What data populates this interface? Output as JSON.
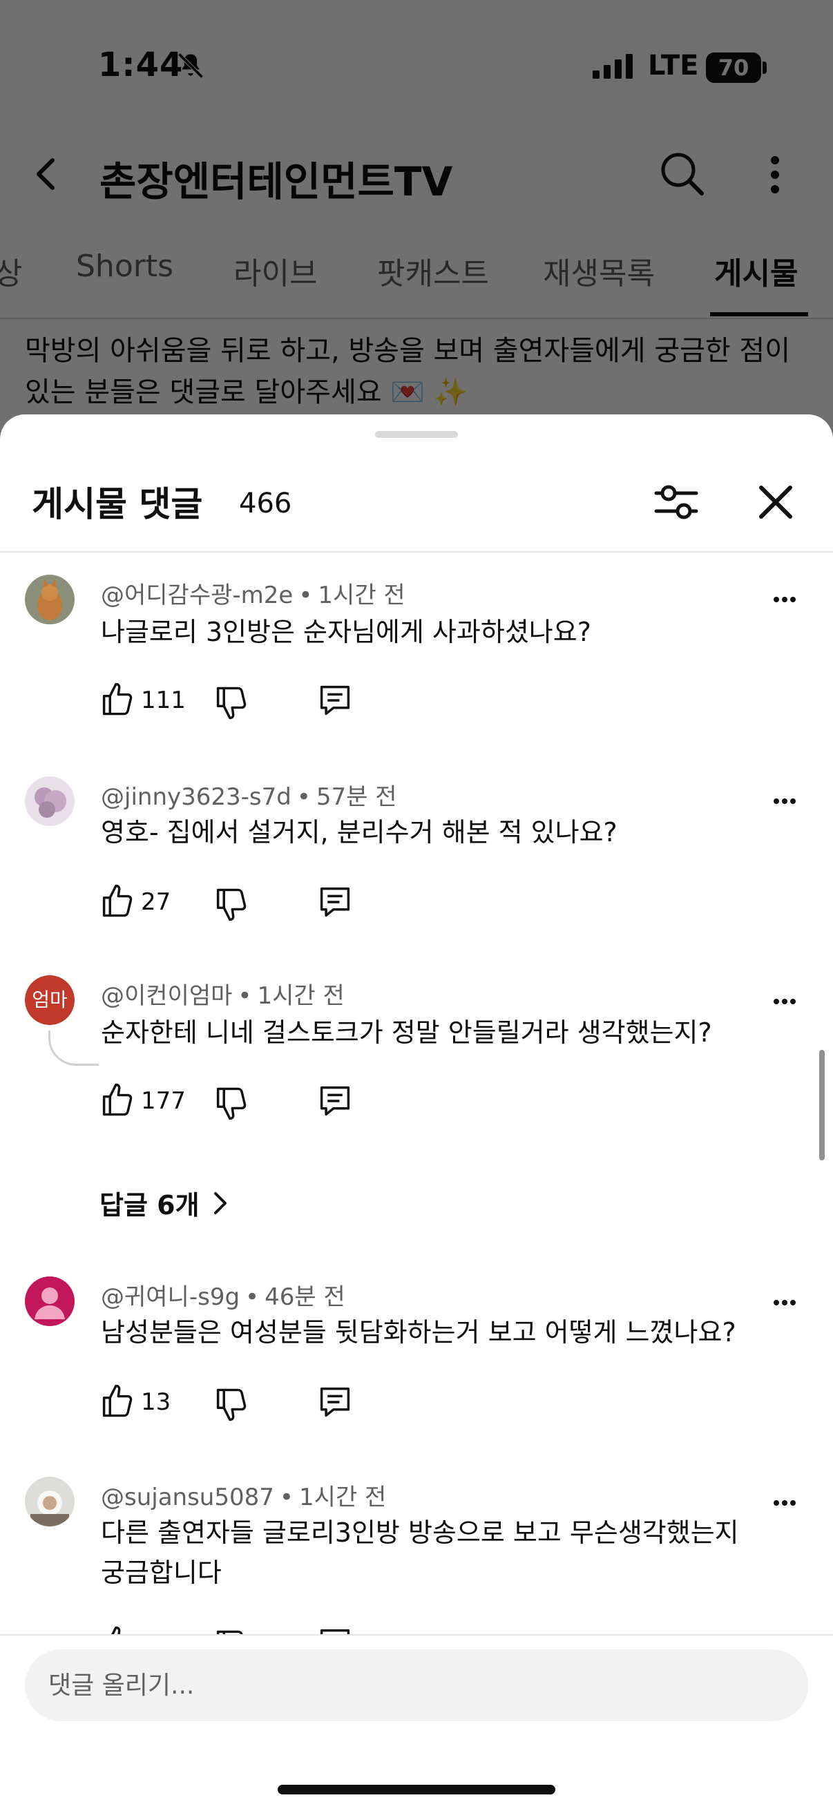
{
  "status_bar": {
    "time": "1:44",
    "network": "LTE",
    "battery": "70",
    "icons": [
      "bell-slash-icon",
      "signal-icon"
    ]
  },
  "header": {
    "channel_name": "촌장엔터테인먼트TV",
    "icons": [
      "back-icon",
      "search-icon",
      "more-vert-icon"
    ]
  },
  "tabs": [
    {
      "label": "상"
    },
    {
      "label": "Shorts"
    },
    {
      "label": "라이브"
    },
    {
      "label": "팟캐스트"
    },
    {
      "label": "재생목록"
    },
    {
      "label": "게시물",
      "active": true
    }
  ],
  "post": {
    "text": "막방의 아쉬움을 뒤로 하고, 방송을 보며 출연자들에게 궁금한 점이 있는 분들은 댓글로 달아주세요 💌 ✨"
  },
  "sheet": {
    "title": "게시물 댓글",
    "count": "466",
    "icons": [
      "filter-icon",
      "close-icon"
    ]
  },
  "comments": [
    {
      "author": "@어디감수광-m2e",
      "time": "1시간 전",
      "text": "나글로리 3인방은 순자님에게 사과하셨나요?",
      "likes": "111"
    },
    {
      "author": "@jinny3623-s7d",
      "time": "57분 전",
      "text": "영호- 집에서 설거지, 분리수거 해본 적 있나요?",
      "likes": "27"
    },
    {
      "author": "@이컨이엄마",
      "avatar_text": "엄마",
      "time": "1시간 전",
      "text": "순자한테 니네 걸스토크가 정말 안들릴거라 생각했는지?",
      "likes": "177",
      "replies": "답글 6개"
    },
    {
      "author": "@귀여니-s9g",
      "time": "46분 전",
      "text": "남성분들은 여성분들 뒷담화하는거 보고 어떻게 느꼈나요?",
      "likes": "13"
    },
    {
      "author": "@sujansu5087",
      "time": "1시간 전",
      "text": "다른 출연자들 글로리3인방 방송으로 보고 무슨생각했는지 궁금합니다"
    }
  ],
  "input": {
    "placeholder": "댓글 올리기..."
  },
  "colors": {
    "avatar_red": "#c0392b",
    "avatar_pink": "#c2185b",
    "text_primary": "#0f0f0f",
    "text_secondary": "#606060"
  }
}
